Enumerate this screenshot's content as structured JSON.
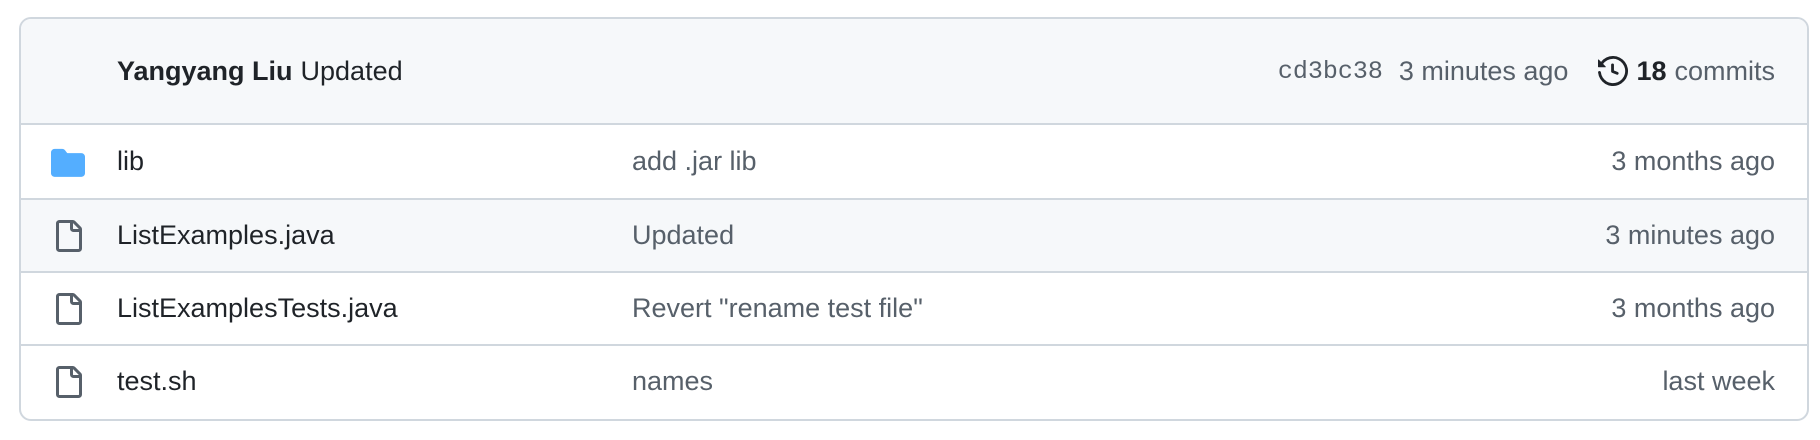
{
  "latest_commit": {
    "author": "Yangyang Liu",
    "message": "Updated",
    "sha": "cd3bc38",
    "time": "3 minutes ago",
    "commit_count": "18",
    "commit_count_label": "commits",
    "history_icon": "history-icon"
  },
  "files": [
    {
      "name": "lib",
      "type": "directory",
      "icon": "folder-icon",
      "message": "add .jar lib",
      "age": "3 months ago"
    },
    {
      "name": "ListExamples.java",
      "type": "file",
      "icon": "file-icon",
      "message": "Updated",
      "age": "3 minutes ago"
    },
    {
      "name": "ListExamplesTests.java",
      "type": "file",
      "icon": "file-icon",
      "message": "Revert \"rename test file\"",
      "age": "3 months ago"
    },
    {
      "name": "test.sh",
      "type": "file",
      "icon": "file-icon",
      "message": "names",
      "age": "last week"
    }
  ],
  "colors": {
    "folder": "#54aeff",
    "file_icon": "#57606a",
    "border": "#d0d7de",
    "header_bg": "#f6f8fa",
    "muted_text": "#57606a"
  }
}
